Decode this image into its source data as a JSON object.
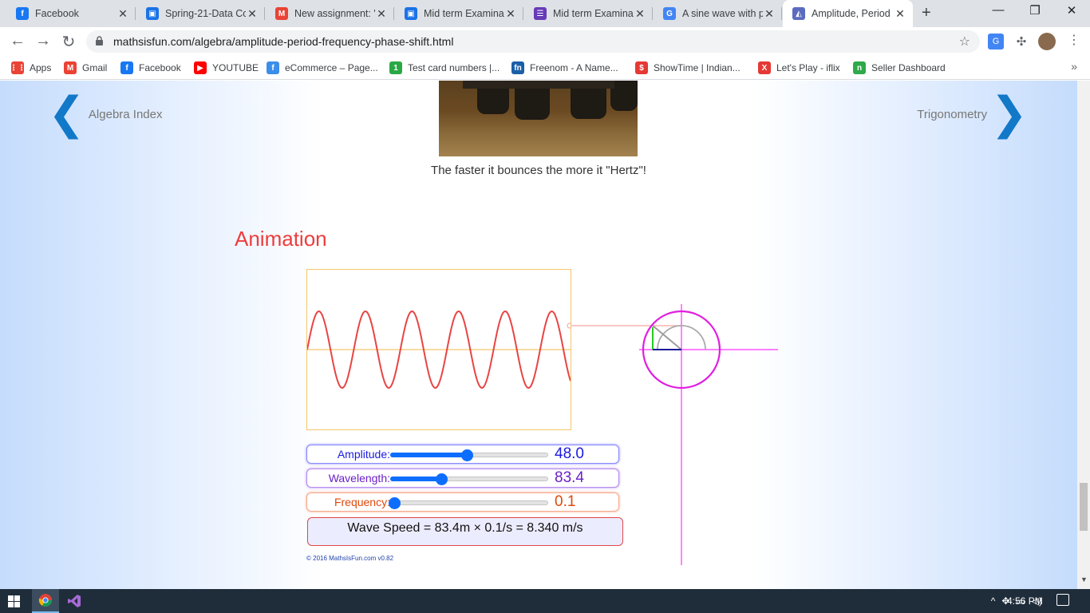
{
  "browser": {
    "tabs": [
      {
        "title": "Facebook",
        "icon": "facebook-icon",
        "color": "#1877f2",
        "glyph": "f",
        "active": false
      },
      {
        "title": "Spring-21-Data Co",
        "icon": "google-classroom-icon",
        "color": "#1a73e8",
        "glyph": "▣",
        "active": false
      },
      {
        "title": "New assignment: '",
        "icon": "gmail-icon",
        "color": "#ea4335",
        "glyph": "M",
        "active": false
      },
      {
        "title": "Mid term Examina",
        "icon": "google-classroom-icon",
        "color": "#1a73e8",
        "glyph": "▣",
        "active": false
      },
      {
        "title": "Mid term Examina",
        "icon": "google-forms-icon",
        "color": "#673ab7",
        "glyph": "☰",
        "active": false
      },
      {
        "title": "A sine wave with p",
        "icon": "google-icon",
        "color": "#4285f4",
        "glyph": "G",
        "active": false
      },
      {
        "title": "Amplitude, Period",
        "icon": "mathsisfun-icon",
        "color": "#5c6bc0",
        "glyph": "◭",
        "active": true
      }
    ],
    "new_tab_label": "+",
    "url": "mathsisfun.com/algebra/amplitude-period-frequency-phase-shift.html",
    "bookmarks": [
      {
        "label": "Apps",
        "icon": "apps-grid-icon",
        "color": "#ea4335",
        "glyph": "⋮⋮"
      },
      {
        "label": "Gmail",
        "icon": "gmail-icon",
        "color": "#ea4335",
        "glyph": "M"
      },
      {
        "label": "Facebook",
        "icon": "facebook-icon",
        "color": "#1877f2",
        "glyph": "f"
      },
      {
        "label": "YOUTUBE",
        "icon": "youtube-icon",
        "color": "#ff0000",
        "glyph": "▶"
      },
      {
        "label": "eCommerce – Page...",
        "icon": "ecommerce-icon",
        "color": "#3b8eea",
        "glyph": "f"
      },
      {
        "label": "Test card numbers |...",
        "icon": "test-card-icon",
        "color": "#2aa845",
        "glyph": "1"
      },
      {
        "label": "Freenom - A Name...",
        "icon": "freenom-icon",
        "color": "#1b5fa8",
        "glyph": "fn"
      },
      {
        "label": "ShowTime | Indian...",
        "icon": "showtime-icon",
        "color": "#e53935",
        "glyph": "$"
      },
      {
        "label": "Let's Play - iflix",
        "icon": "iflix-icon",
        "color": "#e53935",
        "glyph": "X"
      },
      {
        "label": "Seller Dashboard",
        "icon": "seller-dashboard-icon",
        "color": "#2eaa4a",
        "glyph": "n"
      }
    ]
  },
  "page": {
    "prev_label": "Algebra Index",
    "next_label": "Trigonometry",
    "caption": "The faster it bounces the more it \"Hertz\"!",
    "animation_heading": "Animation",
    "controls": {
      "amplitude": {
        "label": "Amplitude:",
        "value": "48.0",
        "fraction": 0.48,
        "color": "#1a1adf",
        "border": "#8888ff"
      },
      "wavelength": {
        "label": "Wavelength:",
        "value": "83.4",
        "fraction": 0.32,
        "color": "#6a1fc8",
        "border": "#b58af0"
      },
      "frequency": {
        "label": "Frequency:",
        "value": "0.1",
        "fraction": 0.02,
        "color": "#e0480a",
        "border": "#f6a98c"
      }
    },
    "wave_speed": "Wave Speed = 83.4m × 0.1/s = 8.340 m/s",
    "copyright": "© 2016 MathsIsFun.com v0.82"
  },
  "taskbar": {
    "time": "4:56 PM",
    "apps": [
      "chrome-icon",
      "visual-studio-icon"
    ]
  }
}
